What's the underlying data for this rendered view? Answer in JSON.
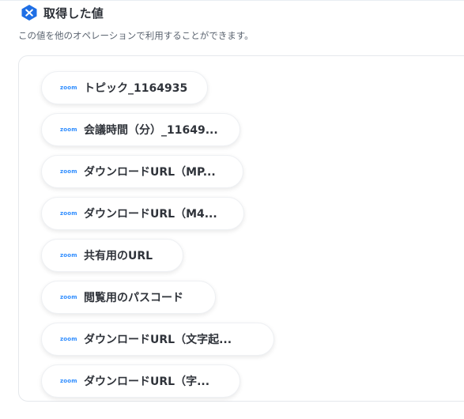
{
  "header": {
    "title": "取得した値",
    "subtitle": "この値を他のオペレーションで利用することができます。",
    "badge_icon": "yoom-logo-icon",
    "badge_color": "#1f6fe5"
  },
  "values": {
    "source_icon_text": "zoom",
    "source_color": "#2d8cff",
    "items": [
      {
        "label": "トピック_1164935"
      },
      {
        "label": "会議時間（分）_11649..."
      },
      {
        "label": "ダウンロードURL（MP..."
      },
      {
        "label": "ダウンロードURL（M4..."
      },
      {
        "label": "共有用のURL"
      },
      {
        "label": "閲覧用のパスコード"
      },
      {
        "label": "ダウンロードURL（文字起..."
      },
      {
        "label": "ダウンロードURL（字..."
      }
    ]
  }
}
